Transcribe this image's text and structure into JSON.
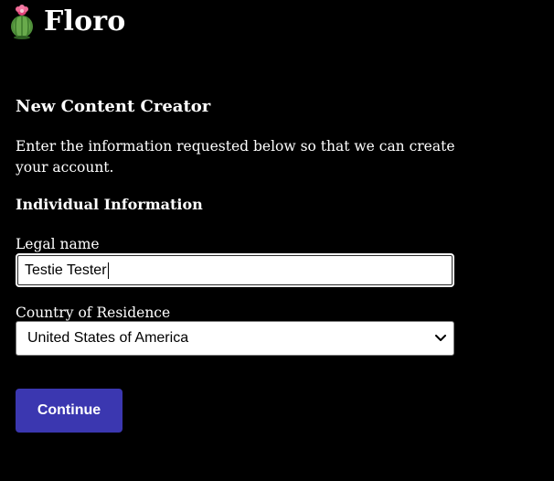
{
  "header": {
    "brand": "Floro",
    "logo_icon": "cactus-flower-icon"
  },
  "form": {
    "title": "New Content Creator",
    "intro": "Enter the information requested below so that we can create your account.",
    "section_title": "Individual Information",
    "legal_name": {
      "label": "Legal name",
      "value": "Testie Tester"
    },
    "country": {
      "label": "Country of Residence",
      "selected": "United States of America"
    },
    "continue_label": "Continue"
  },
  "colors": {
    "background": "#000000",
    "text": "#ffffff",
    "button": "#3b37b0"
  }
}
